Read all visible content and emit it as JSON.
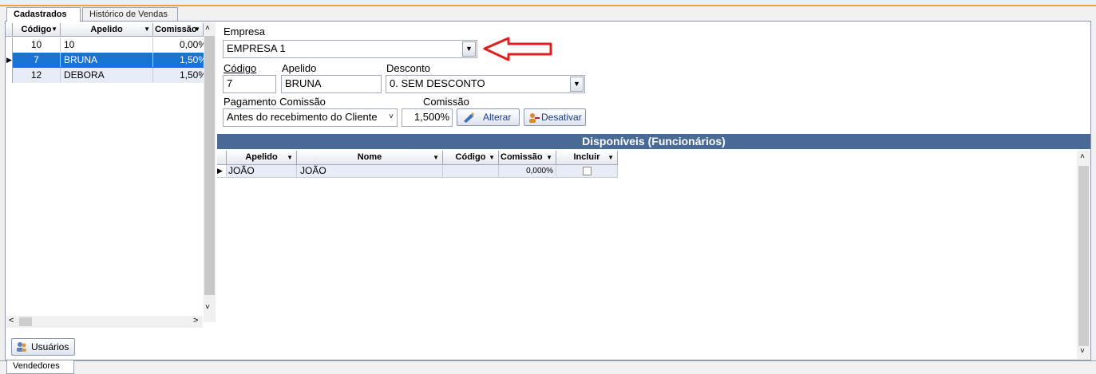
{
  "tabs": {
    "cadastrados": "Cadastrados",
    "historico": "Histórico de Vendas"
  },
  "left_grid": {
    "headers": {
      "codigo": "Código",
      "apelido": "Apelido",
      "comissao": "Comissão"
    },
    "rows": [
      {
        "codigo": "10",
        "apelido": "10",
        "comissao": "0,00%"
      },
      {
        "codigo": "7",
        "apelido": "BRUNA",
        "comissao": "1,50%"
      },
      {
        "codigo": "12",
        "apelido": "DEBORA",
        "comissao": "1,50%"
      }
    ],
    "usuarios_button": "Usuários"
  },
  "form": {
    "empresa_label": "Empresa",
    "empresa_value": "EMPRESA 1",
    "codigo_label": "Código",
    "codigo_value": "7",
    "apelido_label": "Apelido",
    "apelido_value": "BRUNA",
    "desconto_label": "Desconto",
    "desconto_value": "0. SEM DESCONTO",
    "pagamento_label": "Pagamento Comissão",
    "pagamento_value": "Antes do recebimento do Cliente",
    "comissao_label": "Comissão",
    "comissao_value": "1,500%",
    "alterar_button": "Alterar",
    "desativar_button": "Desativar"
  },
  "disponiveis": {
    "title": "Disponíveis (Funcionários)",
    "headers": {
      "apelido": "Apelido",
      "nome": "Nome",
      "codigo": "Código",
      "comissao": "Comissão",
      "incluir": "Incluir"
    },
    "rows": [
      {
        "apelido": "JOÃO",
        "nome": "JOÃO",
        "codigo": "",
        "comissao": "0,000%",
        "incluir": false
      }
    ]
  },
  "bottom_tab": "Vendedores",
  "colors": {
    "selected_row": "#1874d2",
    "header_bar": "#4a6a96",
    "arrow_annotation": "#e02020"
  }
}
